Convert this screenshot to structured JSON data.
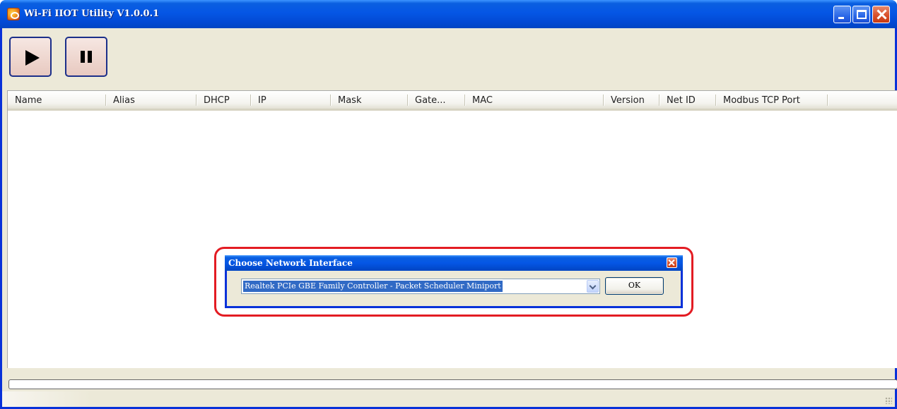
{
  "window": {
    "title": "Wi-Fi IIOT Utility V1.0.0.1",
    "icons": {
      "app": "app-icon",
      "minimize": "minimize-icon",
      "maximize": "maximize-icon",
      "close": "close-icon"
    }
  },
  "toolbar": {
    "buttons": [
      {
        "icon": "play-icon"
      },
      {
        "icon": "pause-icon"
      }
    ]
  },
  "list": {
    "columns": [
      "Name",
      "Alias",
      "DHCP",
      "IP",
      "Mask",
      "Gate...",
      "MAC",
      "Version",
      "Net ID",
      "Modbus TCP Port"
    ],
    "rows": []
  },
  "dialog": {
    "title": "Choose Network Interface",
    "interface_selected": "Realtek PCIe GBE Family Controller - Packet Scheduler Miniport",
    "ok_label": "OK"
  },
  "colors": {
    "titlebar": "#0556e5",
    "window_face": "#ece9d8",
    "highlight": "#e31c23",
    "selection": "#316ac5"
  }
}
